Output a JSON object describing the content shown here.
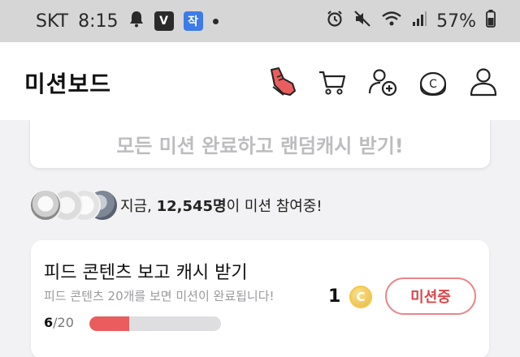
{
  "status_bar": {
    "carrier": "SKT",
    "time": "8:15",
    "badge_v": "V",
    "badge_b": "작",
    "battery": "57%",
    "icons": [
      "bell-icon",
      "alarm-icon",
      "mute-icon",
      "wifi-icon",
      "signal-icon",
      "battery-icon"
    ]
  },
  "header": {
    "title": "미션보드",
    "icons": [
      "shoe-icon",
      "cart-icon",
      "add-friend-icon",
      "coin-icon",
      "profile-icon"
    ],
    "accent": "#e95d5f"
  },
  "banner": {
    "text": "모든 미션 완료하고 랜덤캐시 받기!"
  },
  "participants": {
    "prefix": "지금, ",
    "count": "12,545명",
    "suffix": "이 미션 참여중!"
  },
  "mission": {
    "title": "피드 콘텐츠 보고 캐시 받기",
    "description": "피드 콘텐츠 20개를 보면 미션이 완료됩니다!",
    "progress_current": "6",
    "progress_total": "/20",
    "progress_fraction": 0.3,
    "reward": "1",
    "reward_coin_symbol": "C",
    "button_label": "미션중"
  }
}
